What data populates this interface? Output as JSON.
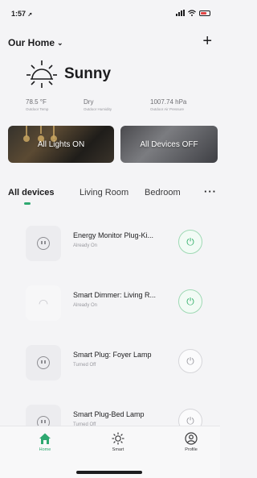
{
  "status": {
    "time": "1:57"
  },
  "header": {
    "home_name": "Our Home",
    "add_label": "+"
  },
  "weather": {
    "condition": "Sunny",
    "temp": {
      "value": "78.5 °F",
      "label": "Outdoor Temp"
    },
    "humidity": {
      "value": "Dry",
      "label": "Outdoor Humidity"
    },
    "pressure": {
      "value": "1007.74 hPa",
      "label": "Outdoor Air Pressure"
    }
  },
  "scenes": [
    {
      "label": "All Lights ON"
    },
    {
      "label": "All Devices OFF"
    }
  ],
  "tabs": [
    {
      "label": "All devices"
    },
    {
      "label": "Living Room"
    },
    {
      "label": "Bedroom"
    }
  ],
  "tabs_more": "···",
  "devices": [
    {
      "name": "Energy Monitor Plug-Ki...",
      "status": "Already On",
      "icon": "outlet-icon",
      "on": true
    },
    {
      "name": "Smart Dimmer: Living R...",
      "status": "Already On",
      "icon": "dimmer-icon",
      "on": true
    },
    {
      "name": "Smart Plug: Foyer Lamp",
      "status": "Turned Off",
      "icon": "outlet-icon",
      "on": false
    },
    {
      "name": "Smart Plug-Bed Lamp",
      "status": "Turned Off",
      "icon": "outlet-icon",
      "on": false
    }
  ],
  "nav": [
    {
      "label": "Home",
      "icon": "home-icon",
      "active": true
    },
    {
      "label": "Smart",
      "icon": "sun-icon",
      "active": false
    },
    {
      "label": "Profile",
      "icon": "profile-icon",
      "active": false
    }
  ],
  "colors": {
    "accent": "#2ea870",
    "power_on": "#34b06b"
  }
}
